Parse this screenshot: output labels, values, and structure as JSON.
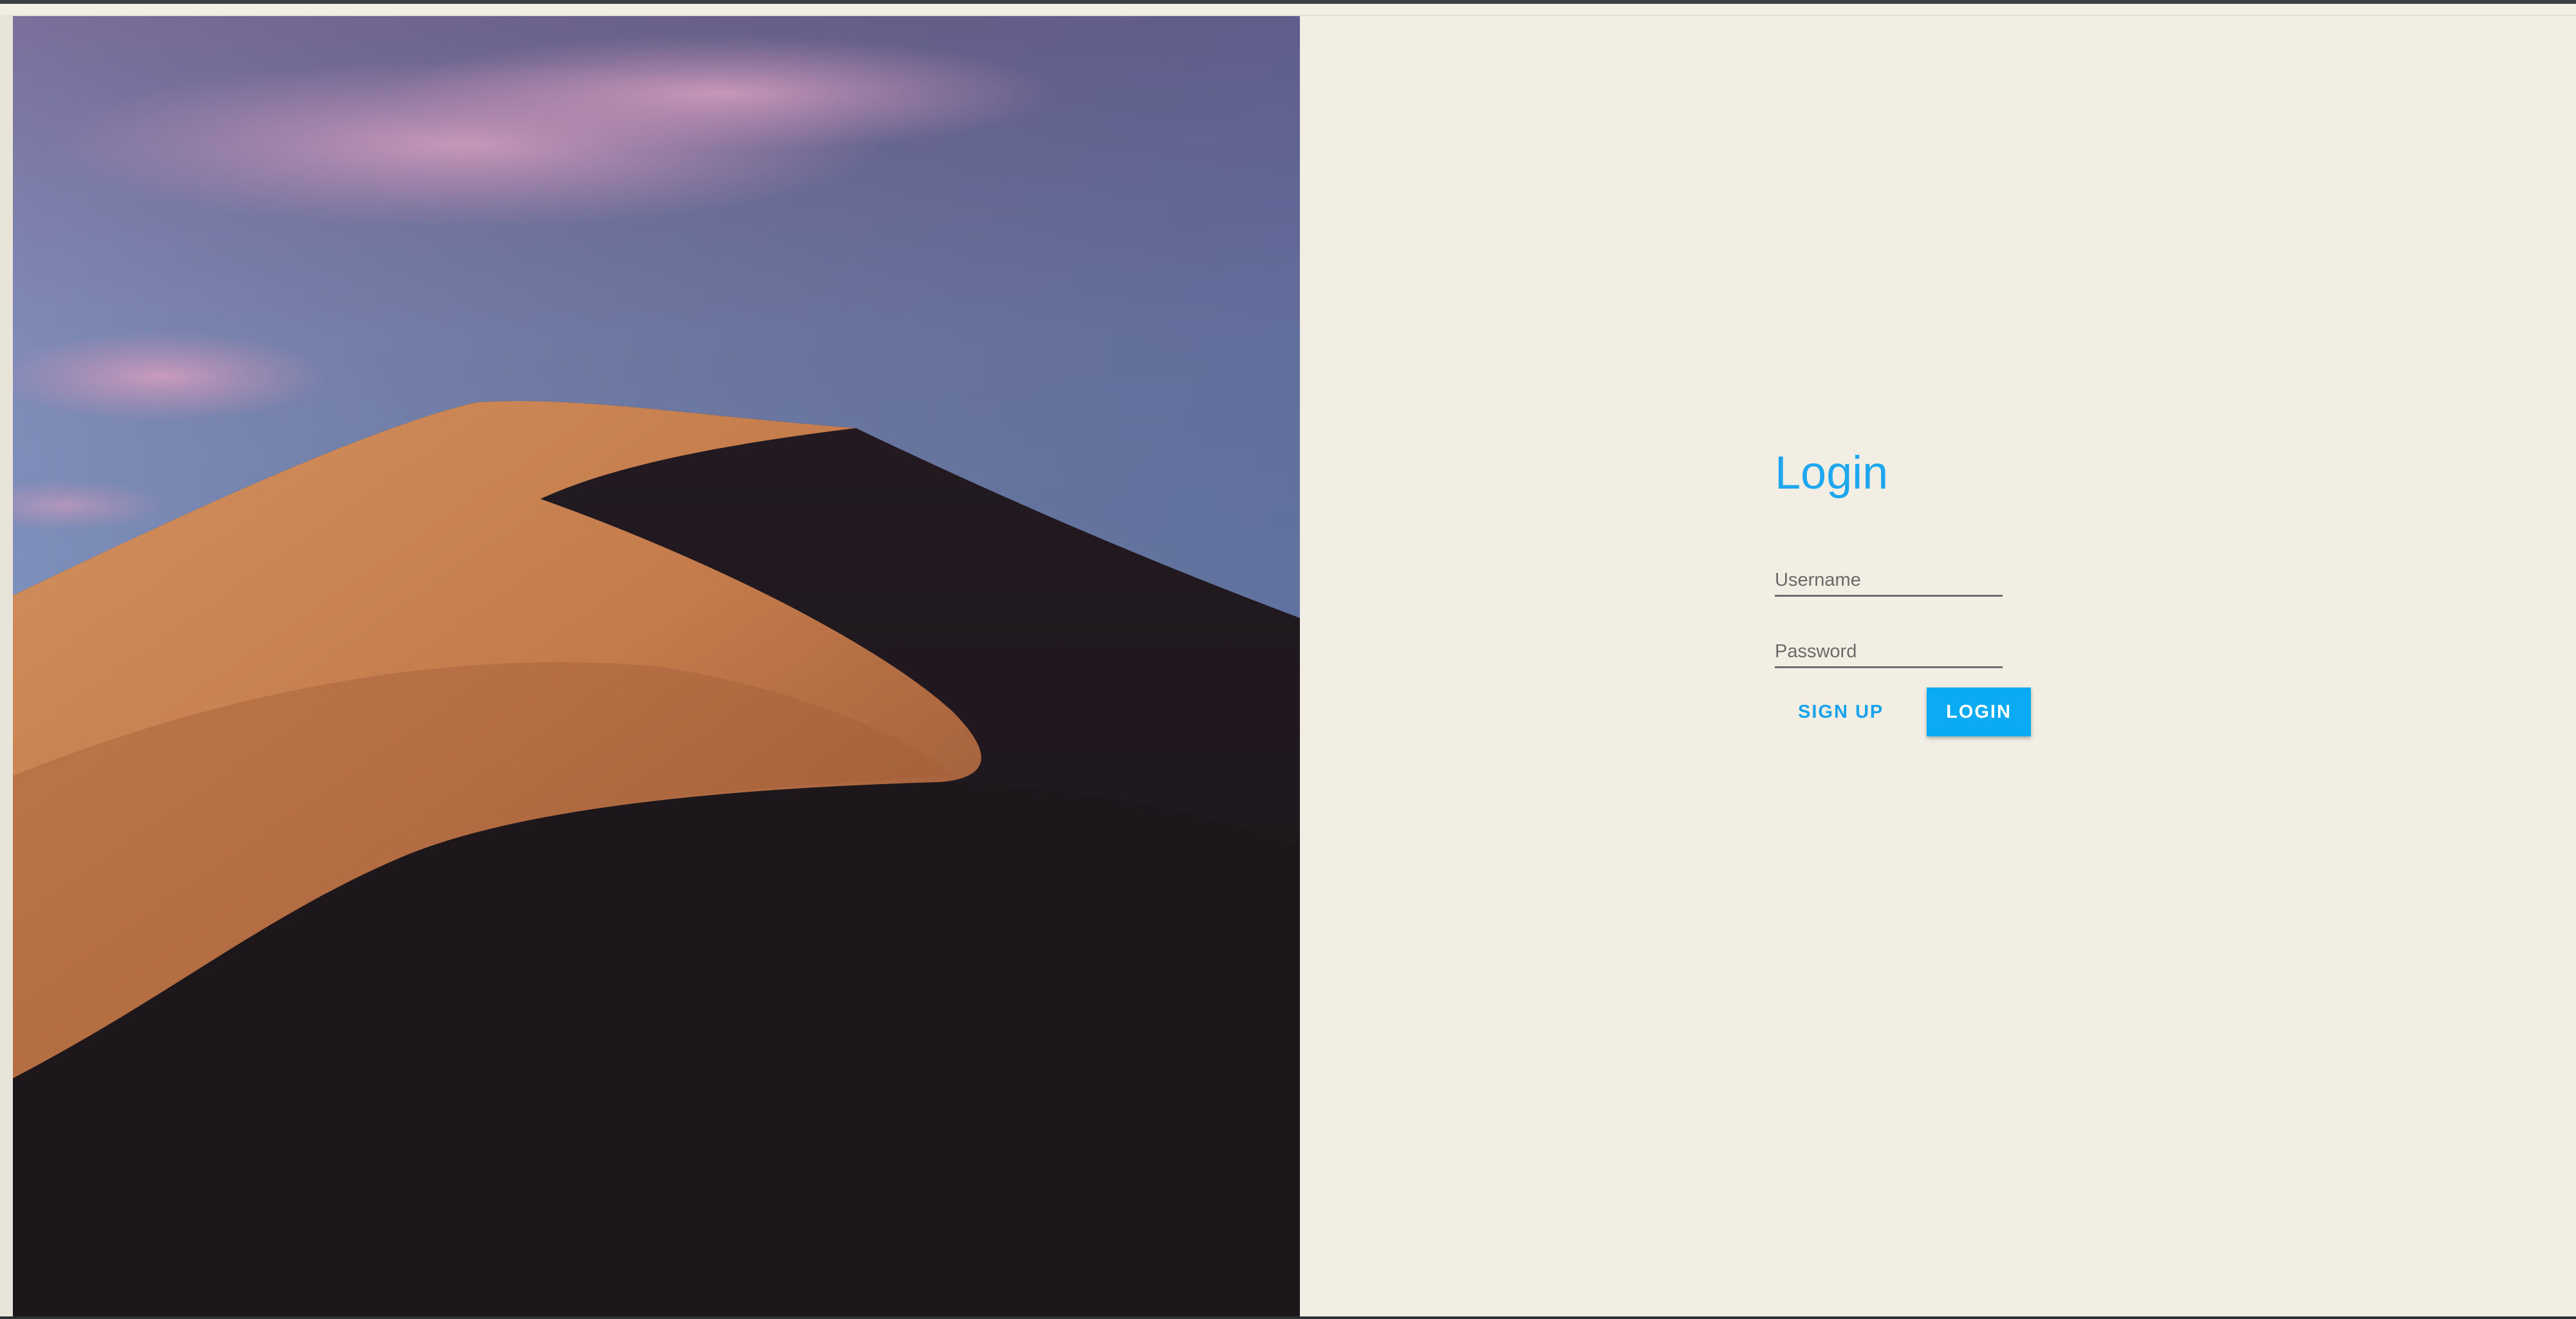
{
  "login": {
    "title": "Login",
    "username_placeholder": "Username",
    "username_value": "",
    "password_placeholder": "Password",
    "password_value": "",
    "signup_label": "SIGN UP",
    "login_label": "LOGIN"
  },
  "colors": {
    "accent": "#0aaaf5",
    "title": "#1ea6ef",
    "background": "#f2eee4"
  }
}
